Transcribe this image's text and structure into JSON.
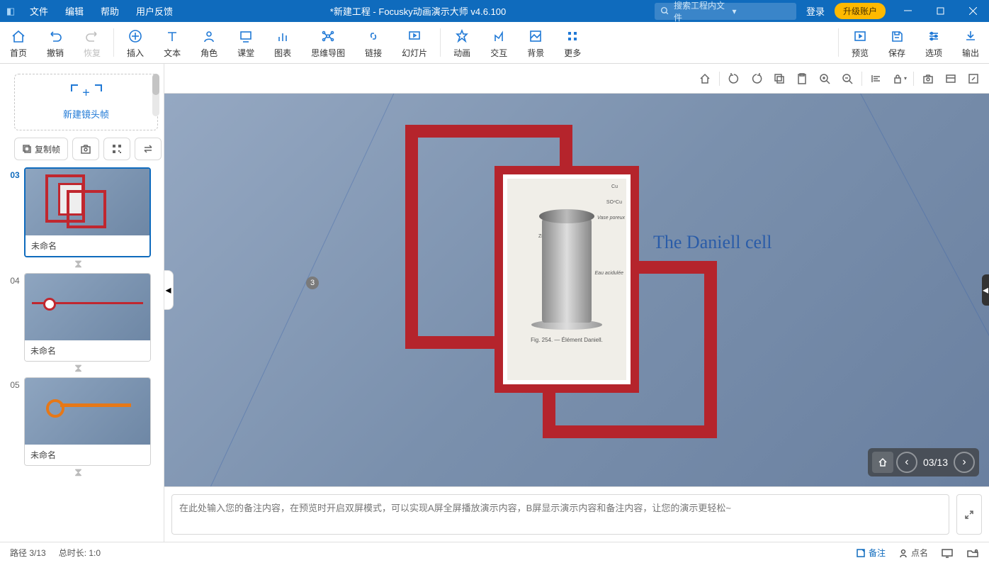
{
  "titlebar": {
    "menus": [
      "文件",
      "编辑",
      "帮助",
      "用户反馈"
    ],
    "title": "*新建工程 - Focusky动画演示大师  v4.6.100",
    "search_placeholder": "搜索工程内文件",
    "login": "登录",
    "upgrade": "升级账户"
  },
  "toolbar": {
    "home": "首页",
    "undo": "撤销",
    "redo": "恢复",
    "insert": "插入",
    "text": "文本",
    "role": "角色",
    "class": "课堂",
    "chart": "图表",
    "mindmap": "思维导图",
    "link": "链接",
    "slide": "幻灯片",
    "anim": "动画",
    "interact": "交互",
    "bg": "背景",
    "more": "更多",
    "preview": "预览",
    "save": "保存",
    "options": "选项",
    "output": "输出"
  },
  "sidepanel": {
    "newframe": "新建镜头帧",
    "copyframe": "复制帧",
    "thumbs": [
      {
        "num": "03",
        "title": "未命名",
        "selected": true,
        "style": "red-boxes"
      },
      {
        "num": "04",
        "title": "未命名",
        "selected": false,
        "style": "lines"
      },
      {
        "num": "05",
        "title": "未命名",
        "selected": false,
        "style": "orange"
      }
    ]
  },
  "canvas": {
    "caption": "The Daniell cell",
    "figure_caption": "Fig. 254. — Élément Daniell.",
    "labels": {
      "cu": "Cu",
      "so4cu": "SO⁴Cu",
      "vase": "Vase poreux",
      "zn": "Zn",
      "eau": "Eau acidulée"
    },
    "badge": "3",
    "nav": {
      "counter": "03/13"
    }
  },
  "notes": {
    "placeholder": "在此处输入您的备注内容，在预览时开启双屏模式，可以实现A屏全屏播放演示内容，B屏显示演示内容和备注内容，让您的演示更轻松~"
  },
  "statusbar": {
    "path": "路径 3/13",
    "duration": "总时长: 1:0",
    "notes": "备注",
    "roll": "点名"
  }
}
